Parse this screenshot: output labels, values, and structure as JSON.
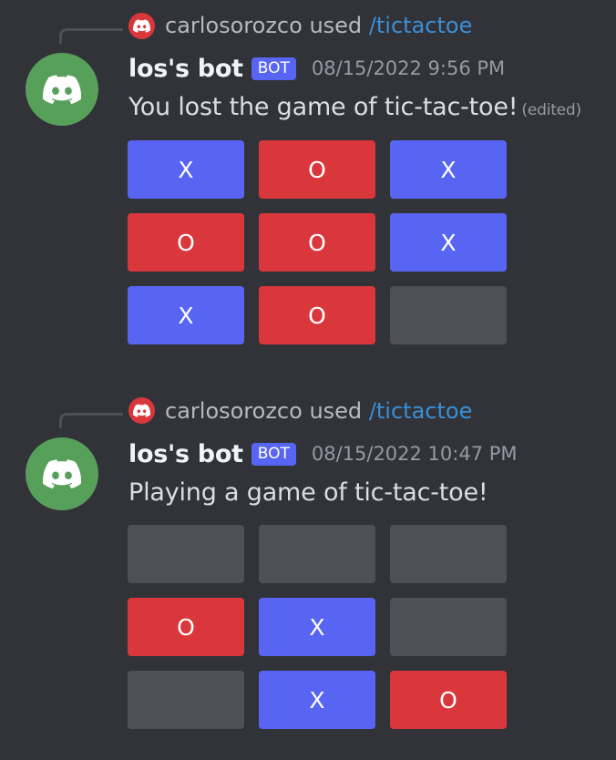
{
  "colors": {
    "background": "#313338",
    "x_button": "#5865f2",
    "o_button": "#da373c",
    "empty_button": "#4e5058",
    "bot_avatar": "#57a05a",
    "command_link": "#3b8fd6",
    "bot_tag": "#5865f2"
  },
  "messages": [
    {
      "reply": {
        "icon": "discord-logo-icon",
        "user": "carlosorozco",
        "used": "used",
        "command": "/tictactoe"
      },
      "avatar_icon": "discord-logo-icon",
      "author": "los's bot",
      "tag": "BOT",
      "timestamp": "08/15/2022 9:56 PM",
      "content": "You lost the game of tic-tac-toe!",
      "edited": "(edited)",
      "board": [
        [
          "X",
          "O",
          "X"
        ],
        [
          "O",
          "O",
          "X"
        ],
        [
          "X",
          "O",
          ""
        ]
      ]
    },
    {
      "reply": {
        "icon": "discord-logo-icon",
        "user": "carlosorozco",
        "used": "used",
        "command": "/tictactoe"
      },
      "avatar_icon": "discord-logo-icon",
      "author": "los's bot",
      "tag": "BOT",
      "timestamp": "08/15/2022 10:47 PM",
      "content": "Playing a game of tic-tac-toe!",
      "edited": "",
      "board": [
        [
          "",
          "",
          ""
        ],
        [
          "O",
          "X",
          ""
        ],
        [
          "",
          "X",
          "O"
        ]
      ]
    }
  ]
}
